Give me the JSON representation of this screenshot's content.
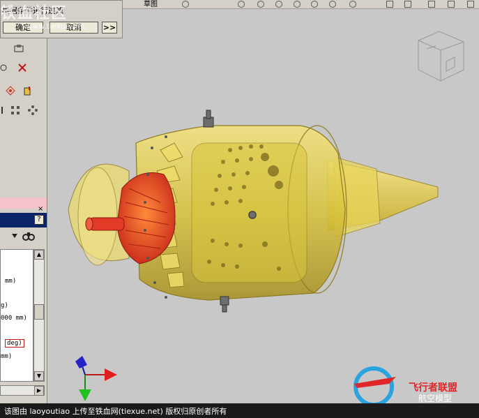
{
  "toolbar": {
    "label": "草图"
  },
  "dialog": {
    "text": "根据条件进行过滤",
    "ok_label": "确定",
    "cancel_label": "取消",
    "more_label": ">>"
  },
  "watermark": {
    "text": "铁血社区",
    "url": "www.tiexue.net"
  },
  "panel": {
    "close_label": "×",
    "help_label": "?",
    "lines": [
      "mm)",
      "g)",
      "000 mm)",
      "deg)",
      "mm)"
    ]
  },
  "caption": "该图由 laoyoutiao 上传至铁血网(tiexue.net) 版权归原创者所有",
  "logo": {
    "title": "飞行者联盟",
    "subtitle": "航空模型"
  },
  "colors": {
    "casing": "#e8d44c",
    "impeller": "#e03a1e",
    "background": "#c8c8c8"
  }
}
